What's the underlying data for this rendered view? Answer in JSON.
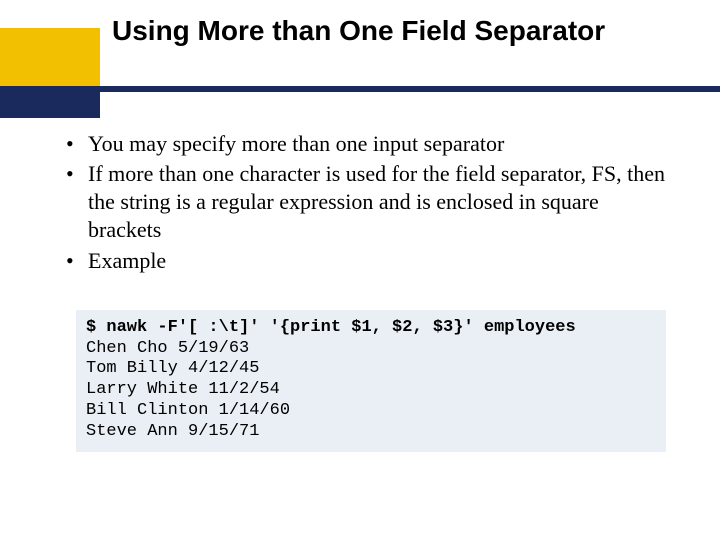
{
  "title": "Using More than One Field Separator",
  "bullets": [
    "You may specify more than one input separator",
    "If more than one character is used for the field separator, FS, then the string is a regular expression and is enclosed in square brackets",
    "Example"
  ],
  "code": {
    "command": "$ nawk -F'[ :\\t]' '{print $1, $2, $3}' employees",
    "output": [
      "Chen Cho 5/19/63",
      "Tom Billy 4/12/45",
      "Larry White 11/2/54",
      "Bill Clinton 1/14/60",
      "Steve Ann 9/15/71"
    ]
  },
  "colors": {
    "accent_yellow": "#f2c000",
    "accent_navy": "#1a2a5c",
    "code_bg": "#e9eff5"
  }
}
